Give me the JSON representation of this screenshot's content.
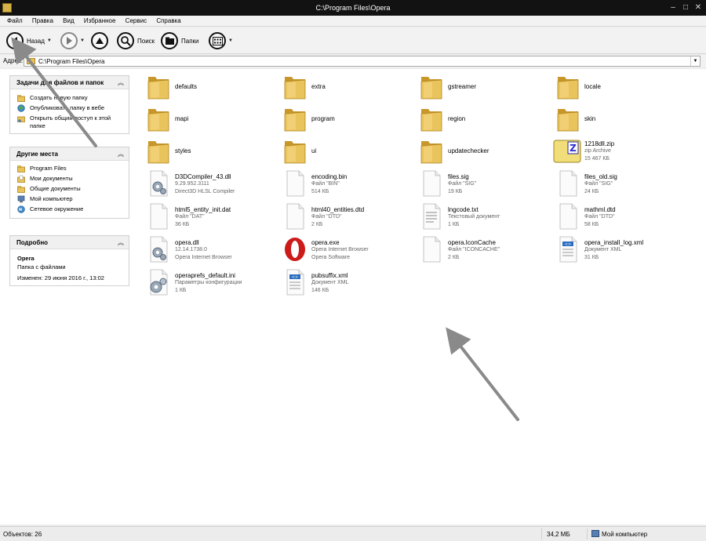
{
  "window": {
    "title": "C:\\Program Files\\Opera",
    "controls": {
      "minimize": "–",
      "maximize": "□",
      "close": "✕"
    }
  },
  "menu": [
    "Файл",
    "Правка",
    "Вид",
    "Избранное",
    "Сервис",
    "Справка"
  ],
  "toolbar": {
    "back_label": "Назад",
    "search_label": "Поиск",
    "folders_label": "Папки"
  },
  "address": {
    "label": "Адрес:",
    "value": "C:\\Program Files\\Opera"
  },
  "sidebar": {
    "tasks": {
      "title": "Задачи для файлов и папок",
      "items": [
        {
          "label": "Создать новую папку",
          "icon": "new-folder-icon"
        },
        {
          "label": "Опубликовать папку в вебе",
          "icon": "web-publish-icon"
        },
        {
          "label": "Открыть общий доступ к этой папке",
          "icon": "share-icon"
        }
      ]
    },
    "places": {
      "title": "Другие места",
      "items": [
        {
          "label": "Program Files",
          "icon": "folder-icon"
        },
        {
          "label": "Мои документы",
          "icon": "documents-icon"
        },
        {
          "label": "Общие документы",
          "icon": "folder-icon"
        },
        {
          "label": "Мой компьютер",
          "icon": "computer-icon"
        },
        {
          "label": "Сетевое окружение",
          "icon": "network-icon"
        }
      ]
    },
    "details": {
      "title": "Подробно",
      "name": "Opera",
      "type": "Папка с файлами",
      "modified": "Изменен: 29 июня 2016 г., 13:02"
    }
  },
  "files": [
    {
      "name": "defaults",
      "kind": "folder"
    },
    {
      "name": "extra",
      "kind": "folder"
    },
    {
      "name": "gstreamer",
      "kind": "folder"
    },
    {
      "name": "locale",
      "kind": "folder"
    },
    {
      "name": "mapi",
      "kind": "folder"
    },
    {
      "name": "program",
      "kind": "folder"
    },
    {
      "name": "region",
      "kind": "folder"
    },
    {
      "name": "skin",
      "kind": "folder"
    },
    {
      "name": "styles",
      "kind": "folder"
    },
    {
      "name": "ui",
      "kind": "folder"
    },
    {
      "name": "updatechecker",
      "kind": "folder"
    },
    {
      "name": "1218dll.zip",
      "kind": "zip",
      "line2": "zip Archive",
      "line3": "15 467 КБ"
    },
    {
      "name": "D3DCompiler_43.dll",
      "kind": "dll",
      "line2": "9.29.952.3111",
      "line3": "Direct3D HLSL Compiler"
    },
    {
      "name": "encoding.bin",
      "kind": "doc",
      "line2": "Файл \"BIN\"",
      "line3": "514 КБ"
    },
    {
      "name": "files.sig",
      "kind": "doc",
      "line2": "Файл \"SIG\"",
      "line3": "19 КБ"
    },
    {
      "name": "files_old.sig",
      "kind": "doc",
      "line2": "Файл \"SIG\"",
      "line3": "24 КБ"
    },
    {
      "name": "html5_entity_init.dat",
      "kind": "doc",
      "line2": "Файл \"DAT\"",
      "line3": "36 КБ"
    },
    {
      "name": "html40_entities.dtd",
      "kind": "doc",
      "line2": "Файл \"DTD\"",
      "line3": "2 КБ"
    },
    {
      "name": "lngcode.txt",
      "kind": "txt",
      "line2": "Текстовый документ",
      "line3": "1 КБ"
    },
    {
      "name": "mathml.dtd",
      "kind": "doc",
      "line2": "Файл \"DTD\"",
      "line3": "58 КБ"
    },
    {
      "name": "opera.dll",
      "kind": "dll",
      "line2": "12.14.1738.0",
      "line3": "Opera Internet Browser"
    },
    {
      "name": "opera.exe",
      "kind": "exe",
      "line2": "Opera Internet Browser",
      "line3": "Opera Software"
    },
    {
      "name": "opera.IconCache",
      "kind": "doc",
      "line2": "Файл \"ICONCACHE\"",
      "line3": "2 КБ"
    },
    {
      "name": "opera_install_log.xml",
      "kind": "xml",
      "line2": "Документ XML",
      "line3": "31 КБ"
    },
    {
      "name": "operaprefs_default.ini",
      "kind": "ini",
      "line2": "Параметры конфигурации",
      "line3": "1 КБ"
    },
    {
      "name": "pubsuffix.xml",
      "kind": "xml",
      "line2": "Документ XML",
      "line3": "146 КБ"
    }
  ],
  "status": {
    "count": "Объектов: 26",
    "size": "34,2 МБ",
    "location": "Мой компьютер"
  },
  "colors": {
    "folder": "#e9c35c",
    "folder_dark": "#c9962a",
    "opera_red": "#cc1b1b",
    "arrow": "#8a8a8a"
  }
}
